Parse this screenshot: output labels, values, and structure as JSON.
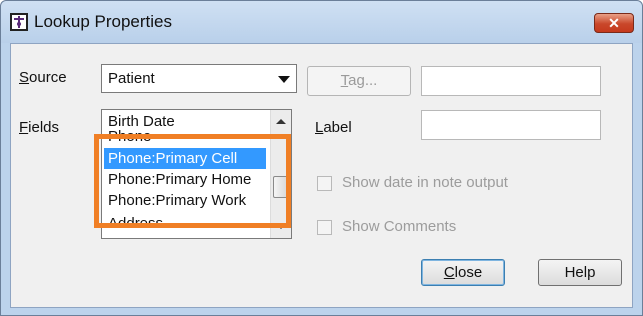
{
  "window": {
    "title": "Lookup Properties",
    "close_icon": "close-icon",
    "close_glyph": "✕"
  },
  "form": {
    "source_label": "Source",
    "source_mnemonic": "S",
    "source_rest": "ource",
    "source_value": "Patient",
    "tag_button_mnemonic": "T",
    "tag_button_rest": "ag...",
    "tag_value": "",
    "fields_label_mnemonic": "F",
    "fields_label_rest": "ields",
    "label_mnemonic": "L",
    "label_rest": "abel",
    "label_value": "",
    "fields_list": {
      "items": [
        "Birth Date",
        "Phone",
        "Phone:Primary Cell",
        "Phone:Primary Home",
        "Phone:Primary Work",
        "Address"
      ],
      "selected": "Phone:Primary Cell"
    },
    "show_date_checkbox": {
      "label": "Show date in note output",
      "checked": false,
      "enabled": false
    },
    "show_comments_checkbox": {
      "label": "Show Comments",
      "checked": false,
      "enabled": false
    }
  },
  "buttons": {
    "close_mnemonic": "C",
    "close_rest": "lose",
    "help": "Help"
  },
  "colors": {
    "highlight": "#f07f25",
    "selection": "#3399ff"
  }
}
